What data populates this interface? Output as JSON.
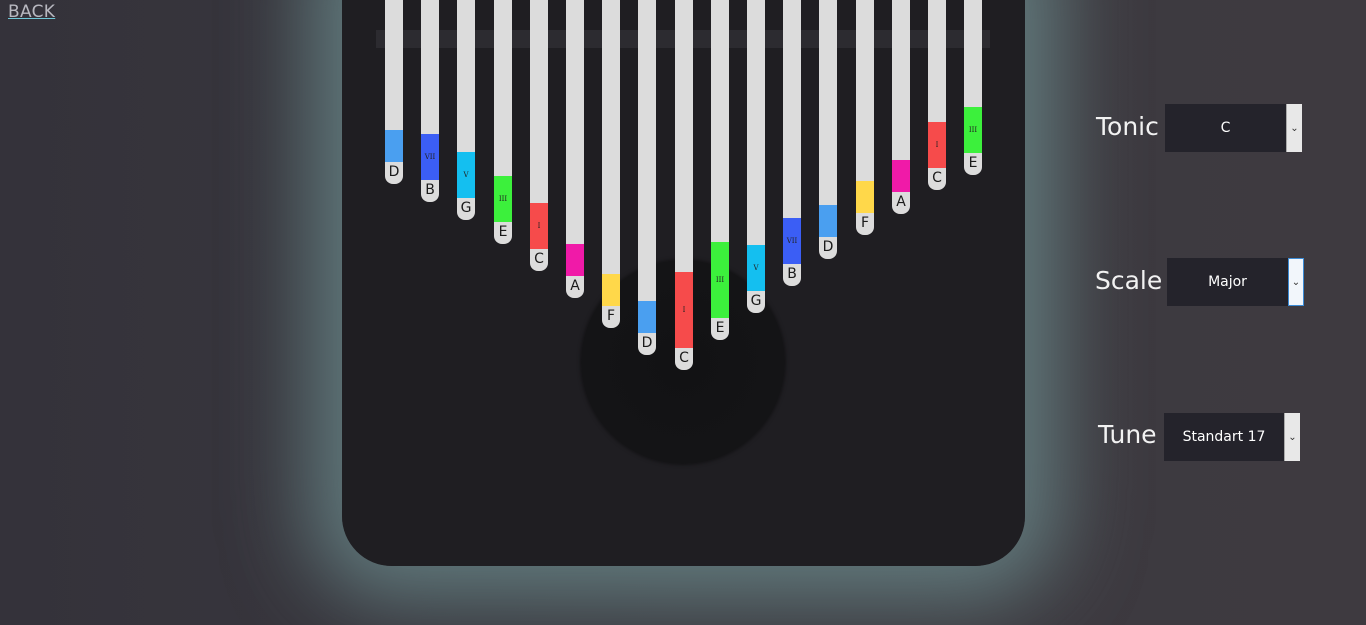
{
  "nav": {
    "back_label": "BACK"
  },
  "controls": {
    "tonic": {
      "label": "Tonic",
      "value": "C"
    },
    "scale": {
      "label": "Scale",
      "value": "Major"
    },
    "tune": {
      "label": "Tune",
      "value": "Standart 17"
    }
  },
  "tines": [
    {
      "note": "D",
      "degree": "",
      "color": "#4a9ff0",
      "level": 0.2
    },
    {
      "note": "B",
      "degree": "VII",
      "color": "#3b5ef5",
      "level": 0.26
    },
    {
      "note": "G",
      "degree": "V",
      "color": "#14bff0",
      "level": 0.32
    },
    {
      "note": "E",
      "degree": "III",
      "color": "#3cf03c",
      "level": 0.4
    },
    {
      "note": "C",
      "degree": "I",
      "color": "#f64b4b",
      "level": 0.49
    },
    {
      "note": "A",
      "degree": "",
      "color": "#f01aa8",
      "level": 0.58
    },
    {
      "note": "F",
      "degree": "",
      "color": "#ffd84a",
      "level": 0.68
    },
    {
      "note": "D",
      "degree": "",
      "color": "#4a9ff0",
      "level": 0.77
    },
    {
      "note": "C",
      "degree": "I",
      "color": "#f64b4b",
      "level": 0.82
    },
    {
      "note": "E",
      "degree": "III",
      "color": "#3cf03c",
      "level": 0.72
    },
    {
      "note": "G",
      "degree": "V",
      "color": "#14bff0",
      "level": 0.63
    },
    {
      "note": "B",
      "degree": "VII",
      "color": "#3b5ef5",
      "level": 0.54
    },
    {
      "note": "D",
      "degree": "",
      "color": "#4a9ff0",
      "level": 0.45
    },
    {
      "note": "F",
      "degree": "",
      "color": "#ffd84a",
      "level": 0.37
    },
    {
      "note": "A",
      "degree": "",
      "color": "#f01aa8",
      "level": 0.3
    },
    {
      "note": "C",
      "degree": "I",
      "color": "#f64b4b",
      "level": 0.22
    },
    {
      "note": "E",
      "degree": "III",
      "color": "#3cf03c",
      "level": 0.17
    }
  ]
}
